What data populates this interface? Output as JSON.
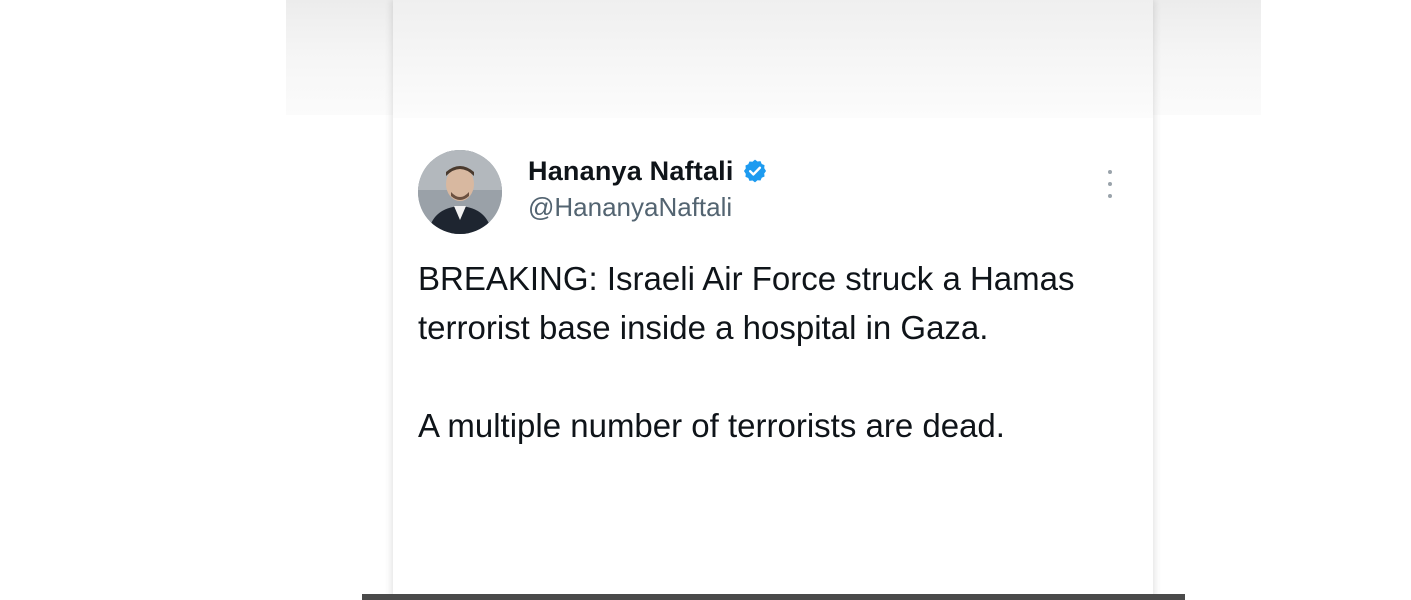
{
  "tweet": {
    "author": {
      "display_name": "Hananya Naftali",
      "handle": "@HananyaNaftali",
      "verified": true,
      "verified_color": "#1d9bf0"
    },
    "paragraphs": [
      "BREAKING: Israeli Air Force struck a Hamas terrorist base inside a hospital in Gaza.",
      "A multiple number of terrorists are dead."
    ]
  },
  "icons": {
    "verified": "verified-badge-icon",
    "more": "more-options-icon"
  },
  "colors": {
    "text_primary": "#0f1419",
    "text_secondary": "#536471",
    "background": "#ffffff"
  }
}
